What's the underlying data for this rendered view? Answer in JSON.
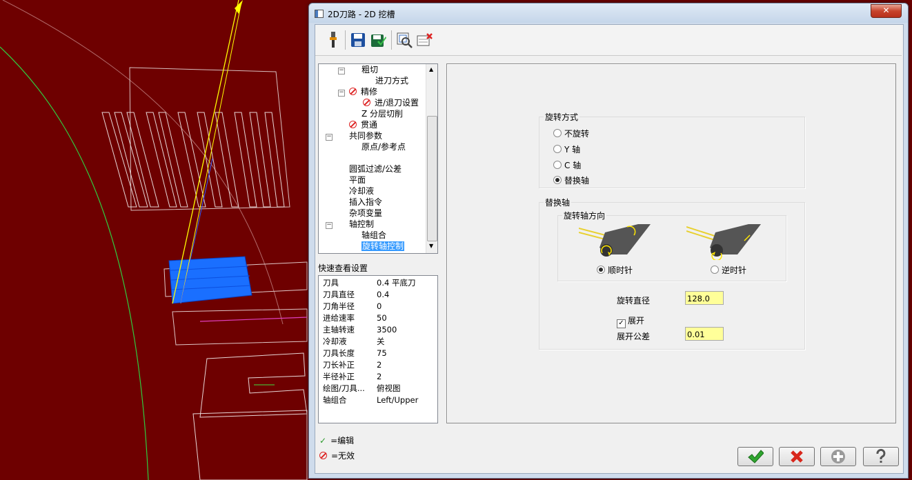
{
  "dialog": {
    "title": "2D刀路 - 2D 挖槽",
    "close_label": "✕"
  },
  "toolbar": {
    "icons": [
      "tool-icon",
      "save-icon",
      "save-all-icon",
      "preview-icon",
      "delete-icon"
    ]
  },
  "tree": {
    "items": [
      {
        "label": "粗切"
      },
      {
        "label": "进刀方式"
      },
      {
        "label": "精修"
      },
      {
        "label": "进/退刀设置"
      },
      {
        "label": "Z 分层切削"
      },
      {
        "label": "贯通"
      },
      {
        "label": "共同参数"
      },
      {
        "label": "原点/参考点"
      },
      {
        "label": "圆弧过滤/公差"
      },
      {
        "label": "平面"
      },
      {
        "label": "冷却液"
      },
      {
        "label": "插入指令"
      },
      {
        "label": "杂项变量"
      },
      {
        "label": "轴控制"
      },
      {
        "label": "轴组合"
      },
      {
        "label": "旋转轴控制"
      }
    ]
  },
  "quick_view": {
    "title": "快速查看设置",
    "rows": [
      {
        "k": "刀具",
        "v": "0.4 平底刀"
      },
      {
        "k": "刀具直径",
        "v": "0.4"
      },
      {
        "k": "刀角半径",
        "v": "0"
      },
      {
        "k": "进给速率",
        "v": "50"
      },
      {
        "k": "主轴转速",
        "v": "3500"
      },
      {
        "k": "冷却液",
        "v": "关"
      },
      {
        "k": "刀具长度",
        "v": "75"
      },
      {
        "k": "刀长补正",
        "v": "2"
      },
      {
        "k": "半径补正",
        "v": "2"
      },
      {
        "k": "绘图/刀具...",
        "v": "俯视图"
      },
      {
        "k": "轴组合",
        "v": "Left/Upper"
      }
    ]
  },
  "legend": {
    "edit": "=编辑",
    "invalid": "=无效"
  },
  "rotation_mode": {
    "title": "旋转方式",
    "options": [
      "不旋转",
      "Y 轴",
      "C 轴",
      "替换轴"
    ],
    "selected": "替换轴"
  },
  "replace_axis": {
    "title": "替换轴",
    "direction_title": "旋转轴方向",
    "cw_label": "顺时针",
    "ccw_label": "逆时针",
    "selected_direction": "顺时针",
    "diameter_label": "旋转直径",
    "diameter_value": "128.0",
    "unroll_label": "展开",
    "unroll_checked": true,
    "unroll_tol_label": "展开公差",
    "unroll_tol_value": "0.01"
  },
  "buttons": [
    "ok-button",
    "cancel-button",
    "add-button",
    "help-button"
  ],
  "colors": {
    "viewport_bg": "#6e0000",
    "field_bg": "#ffff99",
    "selection": "#3399ff"
  }
}
